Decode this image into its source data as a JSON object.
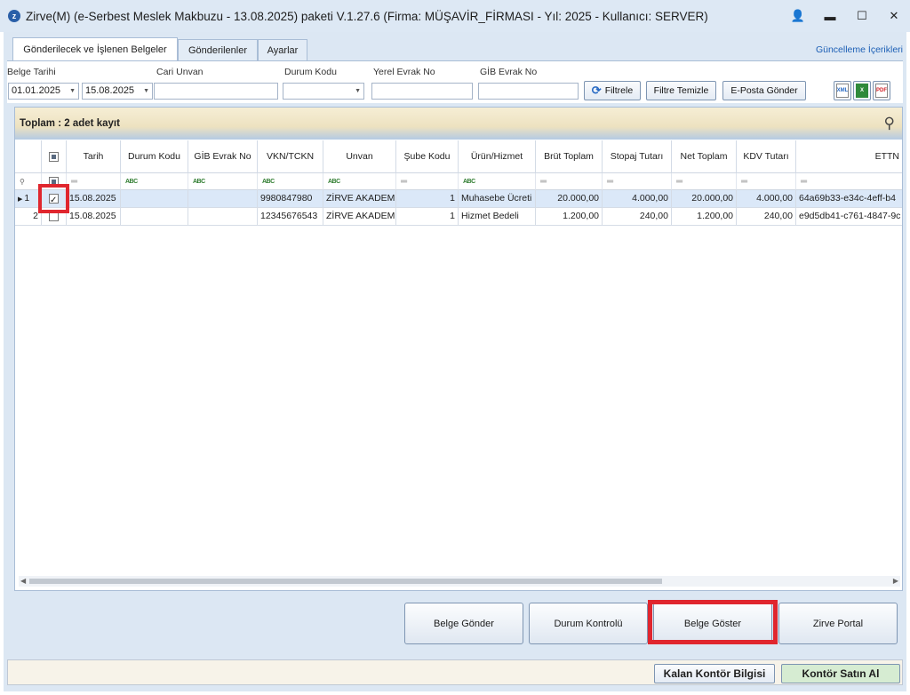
{
  "window": {
    "title": "Zirve(M)  (e-Serbest Meslek Makbuzu - 13.08.2025) paketi V.1.27.6 (Firma: MÜŞAVİR_FİRMASI - Yıl: 2025 - Kullanıcı: SERVER)",
    "icons": {
      "app": "app-icon",
      "user": "user-icon",
      "minimize": "minimize-icon",
      "maximize": "maximize-icon",
      "close": "close-icon"
    },
    "controls": {
      "minimize": "▬",
      "maximize": "☐",
      "close": "✕",
      "user": "👤",
      "app": "z"
    }
  },
  "tabs": [
    "Gönderilecek ve İşlenen Belgeler",
    "Gönderilenler",
    "Ayarlar"
  ],
  "update_link": "Güncelleme İçerikleri",
  "filters": {
    "belge_tarihi_label": "Belge Tarihi",
    "date_from": "01.01.2025",
    "date_to": "15.08.2025",
    "cari_unvan_label": "Cari Unvan",
    "cari_unvan_value": "",
    "durum_kodu_label": "Durum Kodu",
    "durum_kodu_value": "",
    "yerel_evrak_label": "Yerel Evrak No",
    "yerel_evrak_value": "",
    "gib_evrak_label": "GİB Evrak No",
    "gib_evrak_value": "",
    "filter_button": "Filtrele",
    "clear_button": "Filtre Temizle",
    "email_button": "E-Posta Gönder",
    "export_xml": "XML",
    "export_excel": "X",
    "export_pdf": "PDF"
  },
  "grid": {
    "total": "Toplam : 2 adet kayıt",
    "columns": [
      "Tarih",
      "Durum Kodu",
      "GİB Evrak No",
      "VKN/TCKN",
      "Unvan",
      "Şube Kodu",
      "Ürün/Hizmet",
      "Brüt Toplam",
      "Stopaj Tutarı",
      "Net Toplam",
      "KDV Tutarı",
      "ETTN"
    ],
    "rows": [
      {
        "no": "1",
        "checked": true,
        "tarih": "15.08.2025",
        "durum": "",
        "gib": "",
        "vkn": "9980847980",
        "unvan": "ZİRVE AKADEMİ",
        "sube": "1",
        "urun": "Muhasebe Ücreti",
        "brut": "20.000,00",
        "stopaj": "4.000,00",
        "net": "20.000,00",
        "kdv": "4.000,00",
        "ettn": "64a69b33-e34c-4eff-b4"
      },
      {
        "no": "2",
        "checked": false,
        "tarih": "15.08.2025",
        "durum": "",
        "gib": "",
        "vkn": "12345676543",
        "unvan": "ZİRVE AKADEMİ",
        "sube": "1",
        "urun": "Hizmet Bedeli",
        "brut": "1.200,00",
        "stopaj": "240,00",
        "net": "1.200,00",
        "kdv": "240,00",
        "ettn": "e9d5db41-c761-4847-9c"
      }
    ]
  },
  "actions": [
    "Belge Gönder",
    "Durum Kontrolü",
    "Belge Göster",
    "Zirve Portal"
  ],
  "status": {
    "kontor_info": "Kalan Kontör Bilgisi",
    "buy_kontor": "Kontör Satın Al"
  },
  "colors": {
    "highlight": "#e0262e",
    "selected_row": "#dbe8f8",
    "buy_button": "#d6ecd2"
  }
}
